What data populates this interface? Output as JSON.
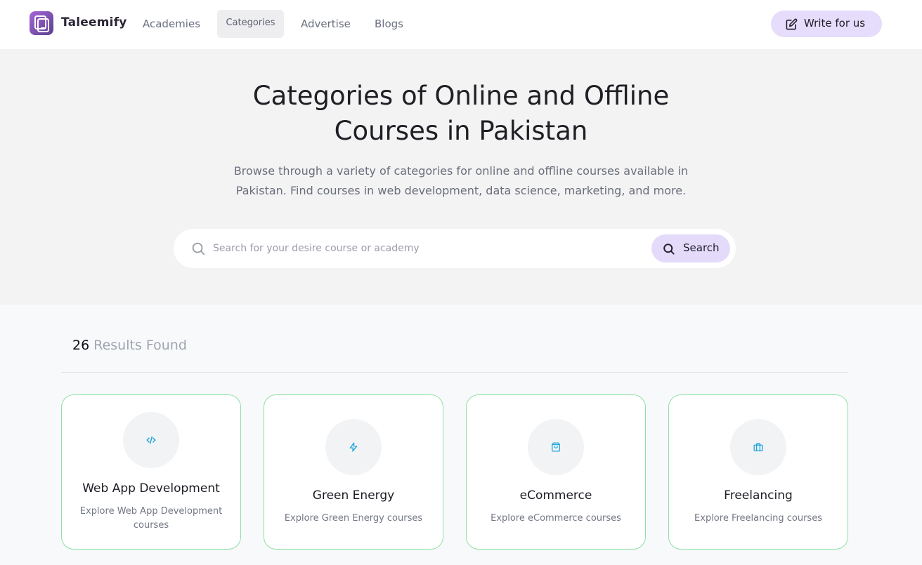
{
  "header": {
    "brand": "Taleemify",
    "nav": [
      {
        "label": "Academies",
        "active": false
      },
      {
        "label": "Categories",
        "active": true
      },
      {
        "label": "Advertise",
        "active": false
      },
      {
        "label": "Blogs",
        "active": false
      }
    ],
    "write_button": {
      "label": "Write for us",
      "icon": "edit-icon"
    }
  },
  "hero": {
    "title_line1": "Categories of Online and Offline",
    "title_line2": "Courses in Pakistan",
    "subtitle_line1": "Browse through a variety of categories for online and offline courses available in",
    "subtitle_line2": "Pakistan. Find courses in web development, data science, marketing, and more.",
    "search": {
      "placeholder": "Search for your desire course or academy",
      "value": "",
      "button_label": "Search"
    }
  },
  "results": {
    "count": "26",
    "label": "Results Found"
  },
  "categories": [
    {
      "title": "Web App Development",
      "desc": "Explore Web App Development courses",
      "icon": "code-icon"
    },
    {
      "title": "Green Energy",
      "desc": "Explore Green Energy courses",
      "icon": "lightning-icon"
    },
    {
      "title": "eCommerce",
      "desc": "Explore eCommerce courses",
      "icon": "shopping-bag-icon"
    },
    {
      "title": "Freelancing",
      "desc": "Explore Freelancing courses",
      "icon": "briefcase-icon"
    }
  ],
  "colors": {
    "accent": "#e6dcfb",
    "card_border": "#8ee0a6",
    "icon_color": "#1aa3d9",
    "hero_bg": "#f3f3f3"
  }
}
